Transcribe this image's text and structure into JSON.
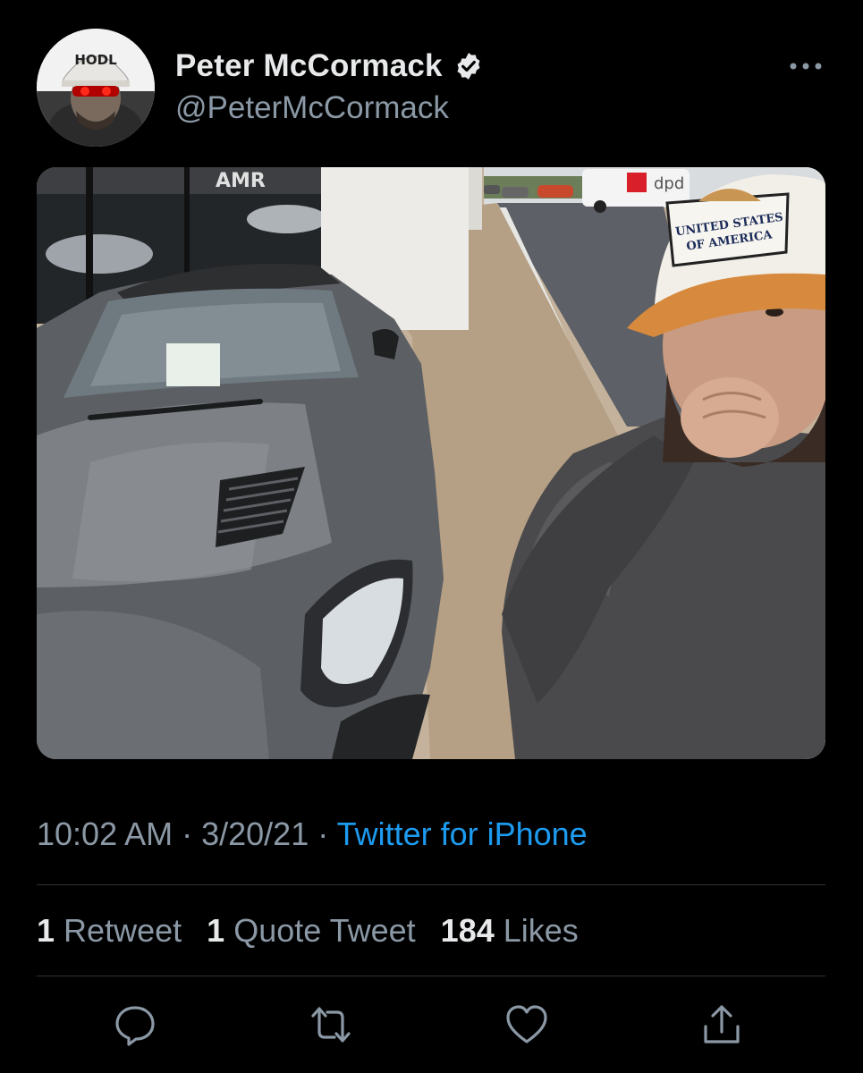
{
  "author": {
    "display_name": "Peter McCormack",
    "handle": "@PeterMcCormack",
    "verified": true,
    "avatar_hat_text": "HODL"
  },
  "icons": {
    "verified": "verified-badge-icon",
    "more": "more-options-icon",
    "reply": "reply-icon",
    "retweet": "retweet-icon",
    "like": "like-icon",
    "share": "share-icon"
  },
  "media": {
    "hat_text_line1": "UNITED STATES",
    "hat_text_line2": "OF AMERICA",
    "storefront_sign": "AMR",
    "van_sign": "dpd"
  },
  "meta": {
    "time": "10:02 AM",
    "separator": " · ",
    "date": "3/20/21",
    "source": "Twitter for iPhone"
  },
  "stats": {
    "retweets_count": "1",
    "retweets_label": "Retweet",
    "quotes_count": "1",
    "quotes_label": "Quote Tweet",
    "likes_count": "184",
    "likes_label": "Likes"
  },
  "colors": {
    "background": "#000000",
    "text_primary": "#e7e9ea",
    "text_secondary": "#8b98a5",
    "link": "#1d9bf0",
    "divider": "#2f3336"
  }
}
